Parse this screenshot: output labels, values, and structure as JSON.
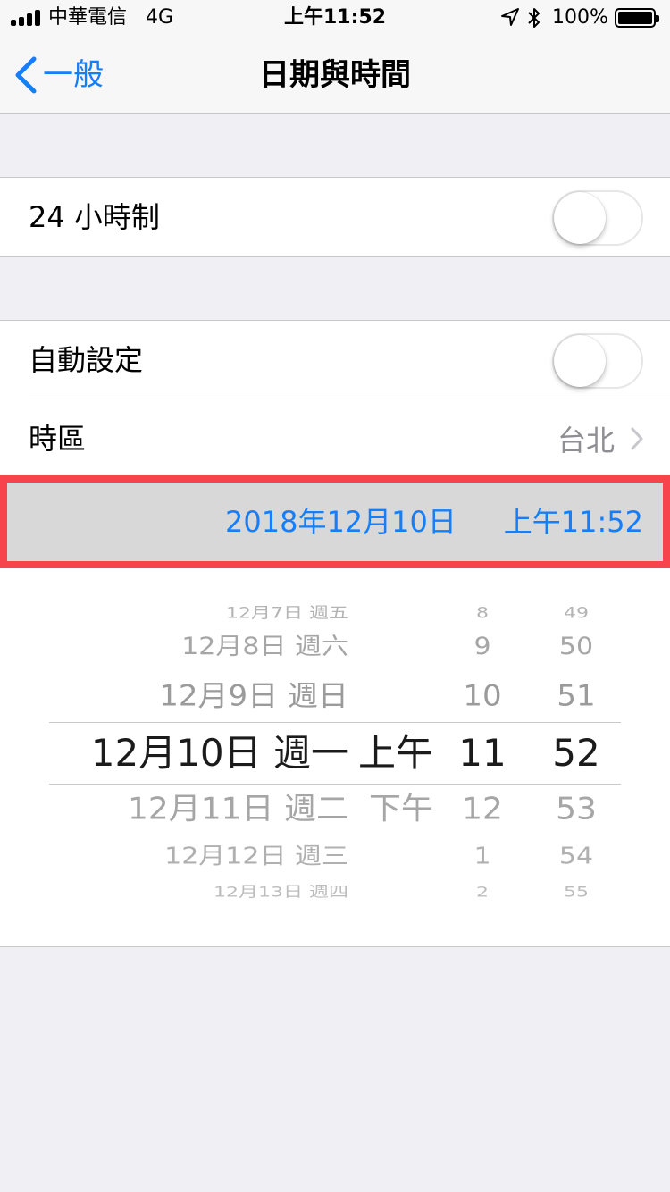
{
  "status": {
    "carrier": "中華電信",
    "network": "4G",
    "time": "上午11:52",
    "battery": "100%"
  },
  "nav": {
    "back_label": "一般",
    "title": "日期與時間"
  },
  "settings": {
    "hour24_label": "24 小時制",
    "hour24_on": false,
    "auto_label": "自動設定",
    "auto_on": false,
    "timezone_label": "時區",
    "timezone_value": "台北"
  },
  "datetime": {
    "date": "2018年12月10日",
    "time": "上午11:52"
  },
  "picker": {
    "date_col": [
      "12月7日 週五",
      "12月8日 週六",
      "12月9日 週日",
      "12月10日 週一",
      "12月11日 週二",
      "12月12日 週三",
      "12月13日 週四"
    ],
    "ampm_col": [
      "",
      "",
      "",
      "上午",
      "下午",
      "",
      ""
    ],
    "hour_col": [
      "8",
      "9",
      "10",
      "11",
      "12",
      "1",
      "2"
    ],
    "minute_col": [
      "49",
      "50",
      "51",
      "52",
      "53",
      "54",
      "55"
    ],
    "selected_index": 3
  },
  "colors": {
    "accent": "#157efb",
    "highlight_border": "#f6434c",
    "background": "#efeff4",
    "secondary_text": "#8e8e93"
  }
}
